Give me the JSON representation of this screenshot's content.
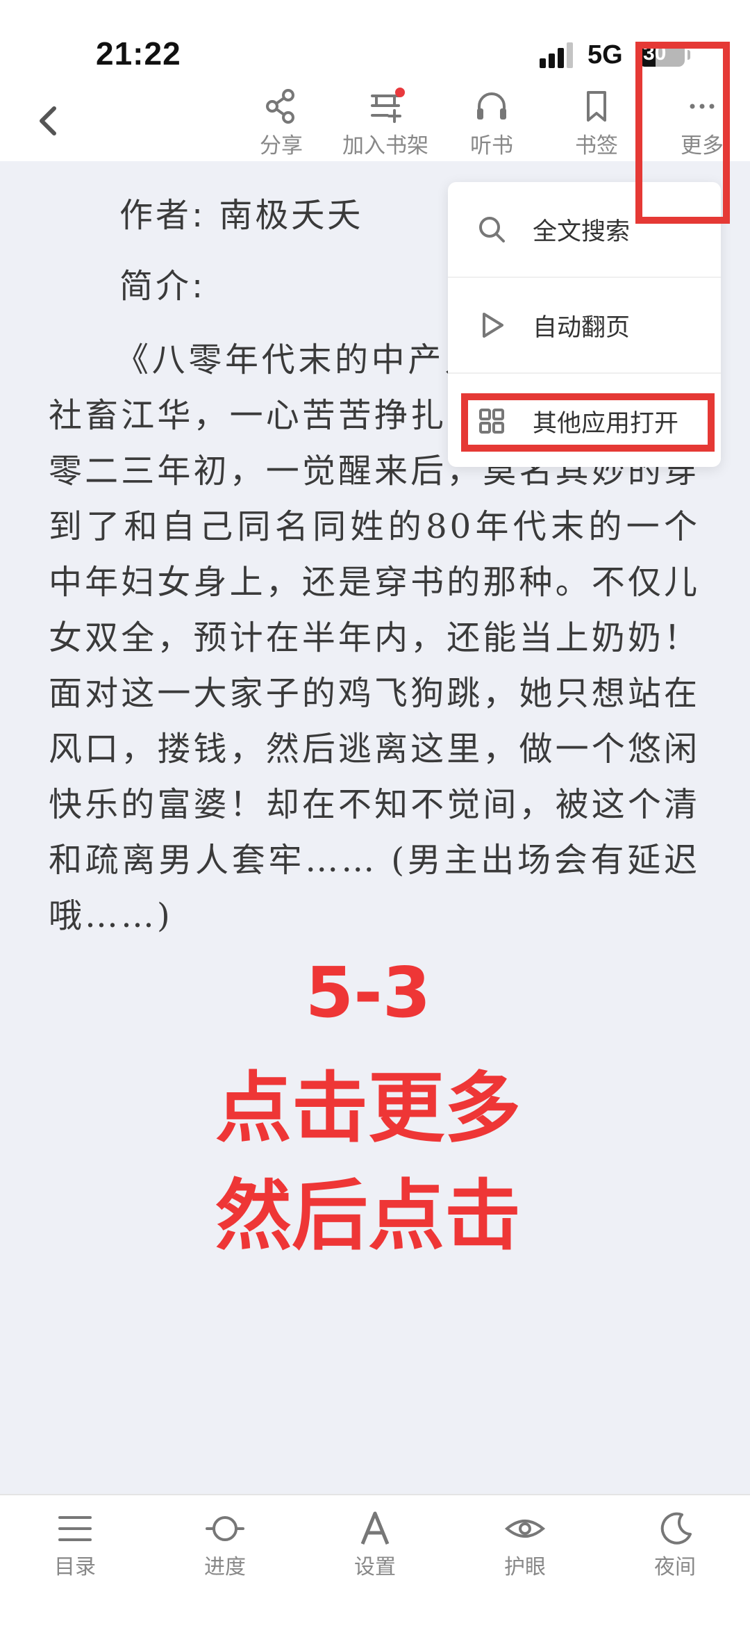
{
  "status_bar": {
    "time": "21:22",
    "network": "5G",
    "battery_level": "30"
  },
  "toolbar": {
    "share": "分享",
    "add_shelf": "加入书架",
    "listen": "听书",
    "bookmark": "书签",
    "more": "更多"
  },
  "book": {
    "author": "作者: 南极夭夭",
    "intro_label": "简介:",
    "intro": "《八零年代末的中产人生》现代都市社畜江华，一心苦苦挣扎在社会底层。二零二三年初，一觉醒来后，莫名其妙的穿到了和自己同名同姓的80年代末的一个中年妇女身上，还是穿书的那种。不仅儿女双全，预计在半年内，还能当上奶奶！面对这一大家子的鸡飞狗跳，她只想站在风口，搂钱，然后逃离这里，做一个悠闲快乐的富婆！却在不知不觉间，被这个清和疏离男人套牢…… (男主出场会有延迟哦……)"
  },
  "menu": {
    "search": "全文搜索",
    "auto_page": "自动翻页",
    "open_with": "其他应用打开"
  },
  "annotation": {
    "step": "5-3",
    "line1": "点击更多",
    "line2": "然后点击",
    "color": "#e53935"
  },
  "bottom_nav": {
    "toc": "目录",
    "progress": "进度",
    "settings": "设置",
    "eye_care": "护眼",
    "night": "夜间"
  }
}
